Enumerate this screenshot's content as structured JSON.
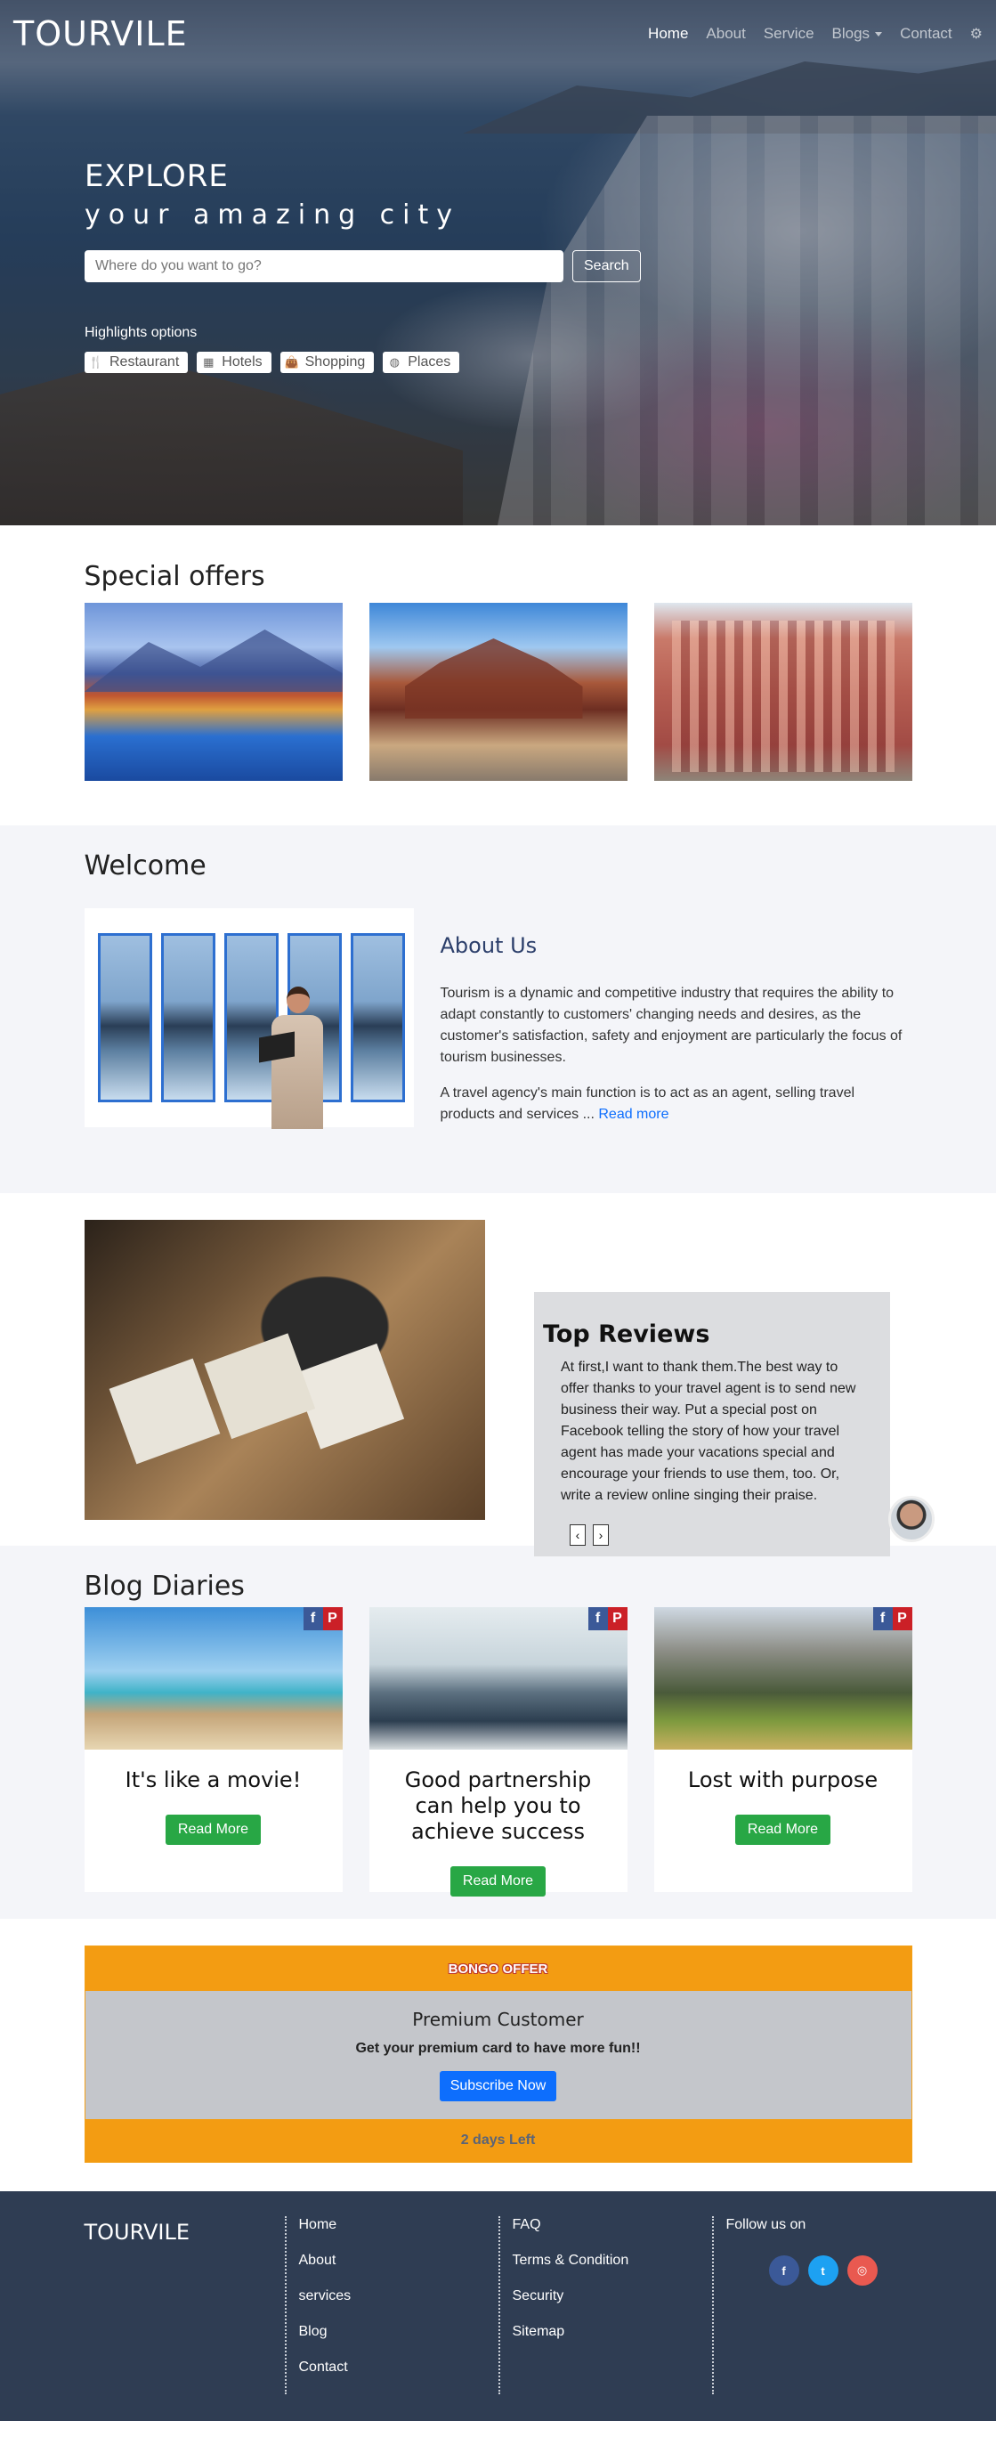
{
  "brand": "TOURVILE",
  "nav": {
    "items": [
      {
        "label": "Home",
        "active": true
      },
      {
        "label": "About"
      },
      {
        "label": "Service"
      },
      {
        "label": "Blogs",
        "dropdown": true
      },
      {
        "label": "Contact"
      }
    ],
    "settings_icon": "gear-icon"
  },
  "hero": {
    "title": "EXPLORE",
    "subtitle": "your amazing city",
    "search_placeholder": "Where do you want to go?",
    "search_button": "Search",
    "highlights_label": "Highlights options",
    "highlights": [
      {
        "label": "Restaurant",
        "icon": "cutlery-icon"
      },
      {
        "label": "Hotels",
        "icon": "building-icon"
      },
      {
        "label": "Shopping",
        "icon": "shopping-bag-icon"
      },
      {
        "label": "Places",
        "icon": "globe-icon"
      }
    ]
  },
  "special": {
    "title": "Special offers"
  },
  "welcome": {
    "title": "Welcome",
    "about_title": "About Us",
    "p1": "Tourism is a dynamic and competitive industry that requires the ability to adapt constantly to customers' changing needs and desires, as the customer's satisfaction, safety and enjoyment are particularly the focus of tourism businesses.",
    "p2": "A travel agency's main function is to act as an agent, selling travel products and services ... ",
    "read_more": "Read more"
  },
  "reviews": {
    "title": "Top Reviews",
    "text": "At first,I want to thank them.The best way to offer thanks to your travel agent is to send new business their way. Put a special post on Facebook telling the story of how your travel agent has made your vacations special and encourage your friends to use them, too. Or, write a review online singing their praise.",
    "prev": "‹",
    "next": "›"
  },
  "blog": {
    "title": "Blog Diaries",
    "posts": [
      {
        "title": "It's like a movie!",
        "button": "Read More"
      },
      {
        "title": "Good partnership can help you to achieve success",
        "button": "Read More"
      },
      {
        "title": "Lost with purpose",
        "button": "Read More"
      }
    ],
    "share_fb": "f",
    "share_pin": "P"
  },
  "offer": {
    "header": "BONGO OFFER",
    "title": "Premium Customer",
    "subtitle": "Get your premium card to have more fun!!",
    "button": "Subscribe Now",
    "footer": "2 days Left"
  },
  "footer": {
    "brand": "TOURVILE",
    "col1": [
      "Home",
      "About",
      "services",
      "Blog",
      "Contact"
    ],
    "col2": [
      "FAQ",
      "Terms & Condition",
      "Security",
      "Sitemap"
    ],
    "follow": "Follow us on",
    "social": [
      {
        "name": "facebook-icon",
        "glyph": "f"
      },
      {
        "name": "twitter-icon",
        "glyph": "t"
      },
      {
        "name": "instagram-icon",
        "glyph": "◎"
      }
    ]
  },
  "colors": {
    "accent_blue": "#0d6efd",
    "green": "#28a745",
    "orange": "#f39c12",
    "footer_bg": "#2f3d53"
  }
}
